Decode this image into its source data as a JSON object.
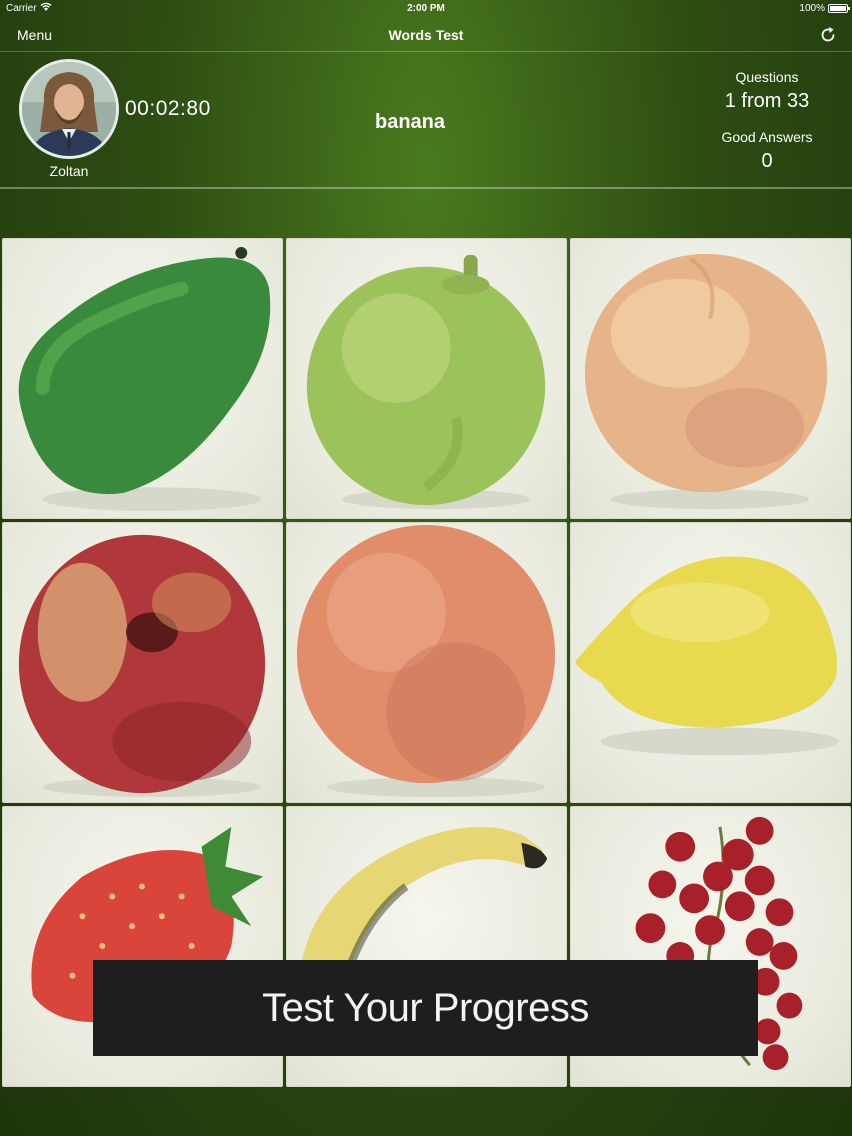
{
  "status_bar": {
    "carrier": "Carrier",
    "time": "2:00 PM",
    "battery": "100%"
  },
  "nav": {
    "menu_label": "Menu",
    "title": "Words Test",
    "refresh_icon": "refresh-icon"
  },
  "player": {
    "name": "Zoltan",
    "timer": "00:02:80"
  },
  "quiz": {
    "word": "banana",
    "questions_label": "Questions",
    "questions_value": "1 from 33",
    "good_answers_label": "Good Answers",
    "good_answers_value": "0"
  },
  "tiles": [
    "avocado",
    "lime",
    "apricot",
    "peach",
    "grapefruit",
    "lemon",
    "strawberry",
    "banana",
    "redcurrant"
  ],
  "banner": {
    "text": "Test Your Progress"
  }
}
